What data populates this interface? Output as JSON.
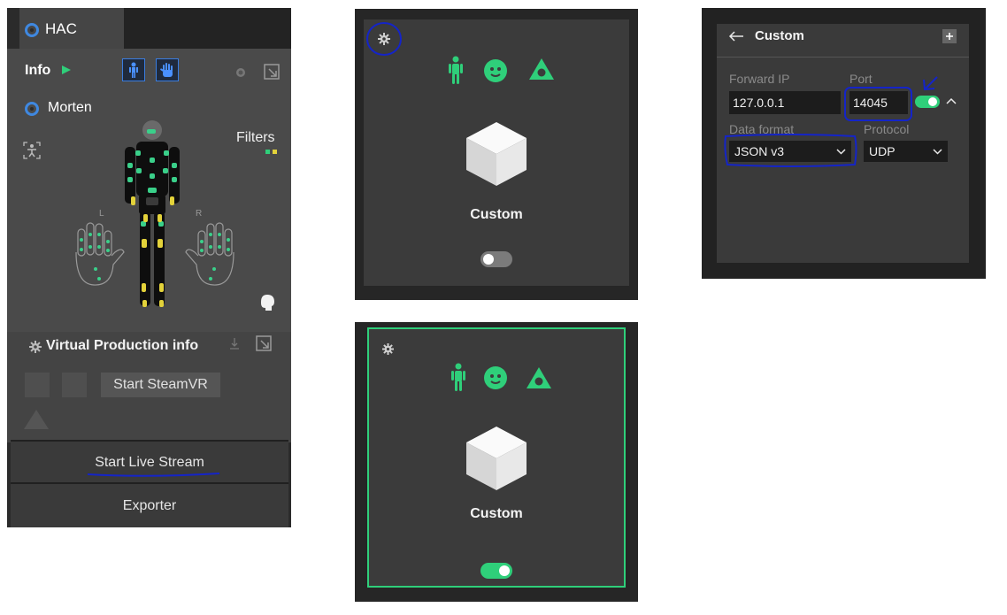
{
  "panel_left": {
    "tab_label": "HAC",
    "info_label": "Info",
    "user_name": "Morten",
    "filters_label": "Filters",
    "glove_left": "L",
    "glove_right": "R",
    "vp_title": "Virtual Production info",
    "steamvr_button": "Start SteamVR",
    "live_stream_button": "Start Live Stream",
    "exporter_button": "Exporter"
  },
  "card_off": {
    "title": "Custom",
    "toggle_on": false
  },
  "card_on": {
    "title": "Custom",
    "toggle_on": true
  },
  "custom_settings": {
    "title": "Custom",
    "forward_ip_label": "Forward IP",
    "forward_ip_value": "127.0.0.1",
    "port_label": "Port",
    "port_value": "14045",
    "data_format_label": "Data format",
    "data_format_value": "JSON v3",
    "protocol_label": "Protocol",
    "protocol_value": "UDP",
    "enabled": true
  },
  "colors": {
    "accent_green": "#2fcf7a",
    "annotation_blue": "#1424c8",
    "radio_blue": "#3f88e0"
  }
}
